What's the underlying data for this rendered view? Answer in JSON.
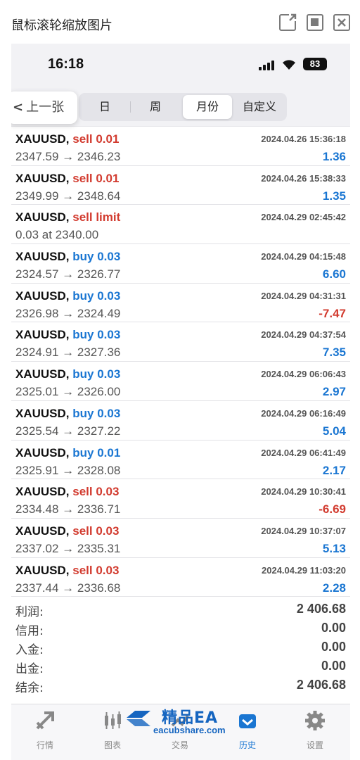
{
  "viewer": {
    "title": "鼠标滚轮缩放图片"
  },
  "status_bar": {
    "time": "16:18",
    "battery": "83"
  },
  "nav": {
    "back_label": "上一张",
    "segments": [
      "日",
      "周",
      "月份",
      "自定义"
    ],
    "active_segment": "月份"
  },
  "trades": [
    {
      "symbol": "XAUUSD,",
      "action": "sell 0.01",
      "side": "sell",
      "price": "2347.59 → 2346.23",
      "datetime": "2024.04.26 15:36:18",
      "profit": "1.36",
      "profit_sign": "pos"
    },
    {
      "symbol": "XAUUSD,",
      "action": "sell 0.01",
      "side": "sell",
      "price": "2349.99 → 2348.64",
      "datetime": "2024.04.26 15:38:33",
      "profit": "1.35",
      "profit_sign": "pos"
    },
    {
      "symbol": "XAUUSD,",
      "action": "sell limit",
      "side": "sell",
      "price": "0.03 at 2340.00",
      "datetime": "2024.04.29 02:45:42",
      "profit": "",
      "profit_sign": "pos"
    },
    {
      "symbol": "XAUUSD,",
      "action": "buy 0.03",
      "side": "buy",
      "price": "2324.57 → 2326.77",
      "datetime": "2024.04.29 04:15:48",
      "profit": "6.60",
      "profit_sign": "pos"
    },
    {
      "symbol": "XAUUSD,",
      "action": "buy 0.03",
      "side": "buy",
      "price": "2326.98 → 2324.49",
      "datetime": "2024.04.29 04:31:31",
      "profit": "-7.47",
      "profit_sign": "neg"
    },
    {
      "symbol": "XAUUSD,",
      "action": "buy 0.03",
      "side": "buy",
      "price": "2324.91 → 2327.36",
      "datetime": "2024.04.29 04:37:54",
      "profit": "7.35",
      "profit_sign": "pos"
    },
    {
      "symbol": "XAUUSD,",
      "action": "buy 0.03",
      "side": "buy",
      "price": "2325.01 → 2326.00",
      "datetime": "2024.04.29 06:06:43",
      "profit": "2.97",
      "profit_sign": "pos"
    },
    {
      "symbol": "XAUUSD,",
      "action": "buy 0.03",
      "side": "buy",
      "price": "2325.54 → 2327.22",
      "datetime": "2024.04.29 06:16:49",
      "profit": "5.04",
      "profit_sign": "pos"
    },
    {
      "symbol": "XAUUSD,",
      "action": "buy 0.01",
      "side": "buy",
      "price": "2325.91 → 2328.08",
      "datetime": "2024.04.29 06:41:49",
      "profit": "2.17",
      "profit_sign": "pos"
    },
    {
      "symbol": "XAUUSD,",
      "action": "sell 0.03",
      "side": "sell",
      "price": "2334.48 → 2336.71",
      "datetime": "2024.04.29 10:30:41",
      "profit": "-6.69",
      "profit_sign": "neg"
    },
    {
      "symbol": "XAUUSD,",
      "action": "sell 0.03",
      "side": "sell",
      "price": "2337.02 → 2335.31",
      "datetime": "2024.04.29 10:37:07",
      "profit": "5.13",
      "profit_sign": "pos"
    },
    {
      "symbol": "XAUUSD,",
      "action": "sell 0.03",
      "side": "sell",
      "price": "2337.44 → 2336.68",
      "datetime": "2024.04.29 11:03:20",
      "profit": "2.28",
      "profit_sign": "pos"
    }
  ],
  "summary": [
    {
      "label": "利润:",
      "value": "2 406.68"
    },
    {
      "label": "信用:",
      "value": "0.00"
    },
    {
      "label": "入金:",
      "value": "0.00"
    },
    {
      "label": "出金:",
      "value": "0.00"
    },
    {
      "label": "结余:",
      "value": "2 406.68"
    }
  ],
  "tabbar": [
    {
      "label": "行情",
      "icon": "quotes-icon",
      "active": false
    },
    {
      "label": "图表",
      "icon": "chart-icon",
      "active": false
    },
    {
      "label": "交易",
      "icon": "trade-icon",
      "active": false
    },
    {
      "label": "历史",
      "icon": "history-icon",
      "active": true
    },
    {
      "label": "设置",
      "icon": "settings-icon",
      "active": false
    }
  ],
  "watermark": {
    "title": "精品EA",
    "url": "eacubshare.com"
  },
  "colors": {
    "buy": "#1a76d2",
    "sell": "#d23b2f",
    "active_tab": "#1a76d2"
  }
}
